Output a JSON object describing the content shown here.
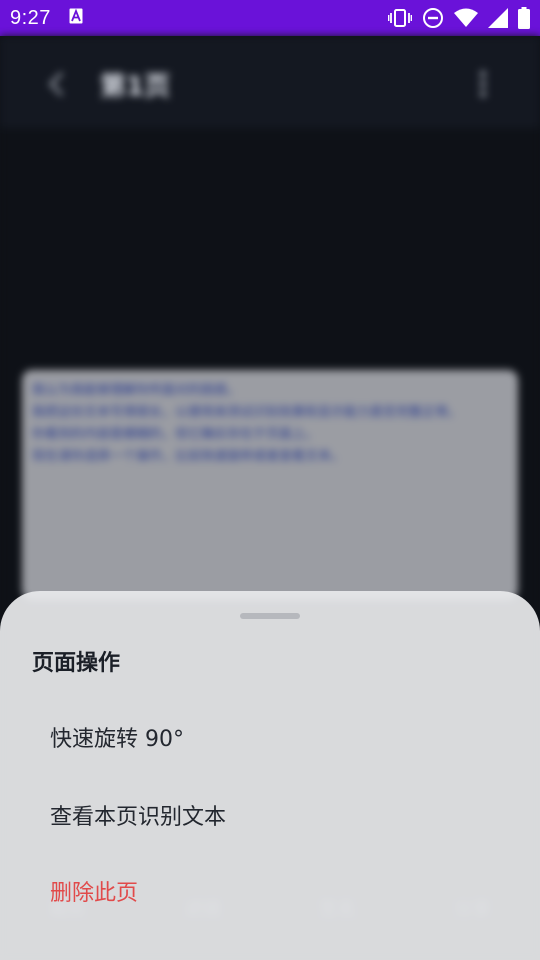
{
  "status_bar": {
    "time": "9:27",
    "notification_icon": "font-a-icon",
    "icons": [
      "vibrate-icon",
      "dnd-icon",
      "wifi-icon",
      "signal-icon",
      "battery-icon"
    ]
  },
  "app": {
    "title": "第1页",
    "back_icon": "back-arrow-icon",
    "more_icon": "more-vertical-icon",
    "preview_lines": [
      "我认为我能够理解你所面对的困惑。",
      "我把这份文本写得很长，以便用来测试识别效果和显示能力是否完整正常。",
      "你看到的内容是模糊的，但它确实存在于页面上。",
      "现在请你选择一个操作，比如快速旋转或者查看文本。"
    ],
    "toolbar": [
      "裁剪",
      "滤镜",
      "签名",
      "分享"
    ]
  },
  "sheet": {
    "title": "页面操作",
    "items": [
      {
        "label": "快速旋转 90°",
        "danger": false
      },
      {
        "label": "查看本页识别文本",
        "danger": false
      },
      {
        "label": "删除此页",
        "danger": true
      }
    ],
    "danger_color": "#e14a4a",
    "status_bar_color": "#6a12d9"
  }
}
